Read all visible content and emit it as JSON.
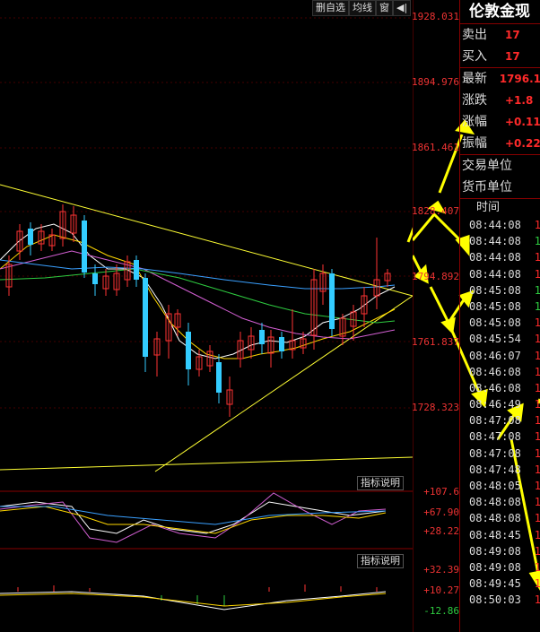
{
  "toolbar": {
    "delete_watch": "删自选",
    "ma_line": "均线",
    "window": "窗",
    "arrow": "◀|"
  },
  "axis_ticks": [
    "1928.031",
    "1894.976",
    "1861.461",
    "1828.407",
    "1794.892",
    "1761.837",
    "1728.323"
  ],
  "indicator1": {
    "label": "指标说明",
    "ticks": [
      "+107.6",
      "+67.90",
      "+28.22"
    ]
  },
  "indicator2": {
    "label": "指标说明",
    "ticks": [
      "+32.39",
      "+10.27",
      "-12.86"
    ]
  },
  "panel": {
    "title": "伦敦金现",
    "sell_label": "卖出",
    "sell_value": "17",
    "buy_label": "买入",
    "buy_value": "17",
    "last_label": "最新",
    "last_value": "1796.1",
    "change_label": "涨跌",
    "change_value": "+1.8",
    "change_pct_label": "涨幅",
    "change_pct_value": "+0.11",
    "amplitude_label": "振幅",
    "amplitude_value": "+0.22",
    "trade_unit_label": "交易单位",
    "currency_unit_label": "货币单位",
    "time_header": "时间",
    "times": [
      {
        "t": "08:44:08",
        "p": "1",
        "g": false
      },
      {
        "t": "08:44:08",
        "p": "1",
        "g": true
      },
      {
        "t": "08:44:08",
        "p": "1",
        "g": false
      },
      {
        "t": "08:44:08",
        "p": "1",
        "g": false
      },
      {
        "t": "08:45:08",
        "p": "1",
        "g": true
      },
      {
        "t": "08:45:08",
        "p": "1",
        "g": true
      },
      {
        "t": "08:45:08",
        "p": "1",
        "g": false
      },
      {
        "t": "08:45:54",
        "p": "1",
        "g": false
      },
      {
        "t": "08:46:07",
        "p": "1",
        "g": false
      },
      {
        "t": "08:46:08",
        "p": "1",
        "g": false
      },
      {
        "t": "08:46:08",
        "p": "1",
        "g": false
      },
      {
        "t": "08:46:49",
        "p": "1",
        "g": false
      },
      {
        "t": "08:47:08",
        "p": "1",
        "g": false
      },
      {
        "t": "08:47:08",
        "p": "1",
        "g": false
      },
      {
        "t": "08:47:08",
        "p": "1",
        "g": false
      },
      {
        "t": "08:47:48",
        "p": "1",
        "g": false
      },
      {
        "t": "08:48:05",
        "p": "1",
        "g": false
      },
      {
        "t": "08:48:08",
        "p": "1",
        "g": false
      },
      {
        "t": "08:48:08",
        "p": "1",
        "g": false
      },
      {
        "t": "08:48:45",
        "p": "1",
        "g": false
      },
      {
        "t": "08:49:08",
        "p": "1",
        "g": false
      },
      {
        "t": "08:49:08",
        "p": "1",
        "g": false
      },
      {
        "t": "08:49:45",
        "p": "1",
        "g": false
      },
      {
        "t": "08:50:03",
        "p": "1",
        "g": false
      }
    ]
  }
}
